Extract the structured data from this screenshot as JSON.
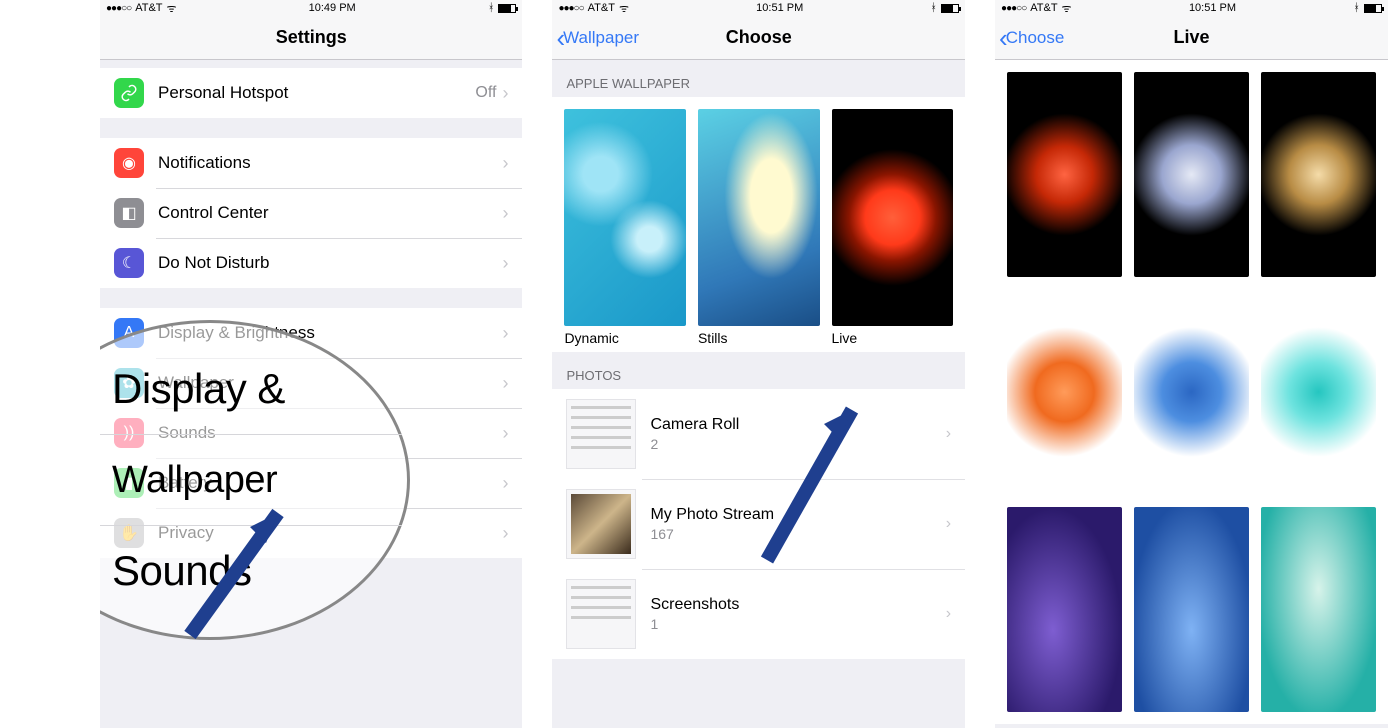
{
  "screen1": {
    "status": {
      "carrier": "AT&T",
      "signal": "●●●○○",
      "time": "10:49 PM"
    },
    "title": "Settings",
    "rows": {
      "hotspot": {
        "label": "Personal Hotspot",
        "value": "Off"
      },
      "notifications": {
        "label": "Notifications"
      },
      "control": {
        "label": "Control Center"
      },
      "dnd": {
        "label": "Do Not Disturb"
      },
      "display": {
        "label": "Display & Brightness"
      },
      "wallpaper": {
        "label": "Wallpaper"
      },
      "sounds": {
        "label": "Sounds"
      },
      "battery": {
        "label": "Battery"
      },
      "privacy": {
        "label": "Privacy"
      }
    },
    "callout": {
      "display_partial": "Display &",
      "wallpaper": "Wallpaper",
      "sounds_partial": "Sounds"
    }
  },
  "screen2": {
    "status": {
      "carrier": "AT&T",
      "signal": "●●●○○",
      "time": "10:51 PM"
    },
    "back": "Wallpaper",
    "title": "Choose",
    "sect_apple": "APPLE WALLPAPER",
    "thumbs": {
      "dynamic": "Dynamic",
      "stills": "Stills",
      "live": "Live"
    },
    "sect_photos": "PHOTOS",
    "photos": {
      "camera": {
        "title": "Camera Roll",
        "count": "2"
      },
      "stream": {
        "title": "My Photo Stream",
        "count": "167"
      },
      "screens": {
        "title": "Screenshots",
        "count": "1"
      }
    }
  },
  "screen3": {
    "status": {
      "carrier": "AT&T",
      "signal": "●●●○○",
      "time": "10:51 PM"
    },
    "back": "Choose",
    "title": "Live"
  }
}
